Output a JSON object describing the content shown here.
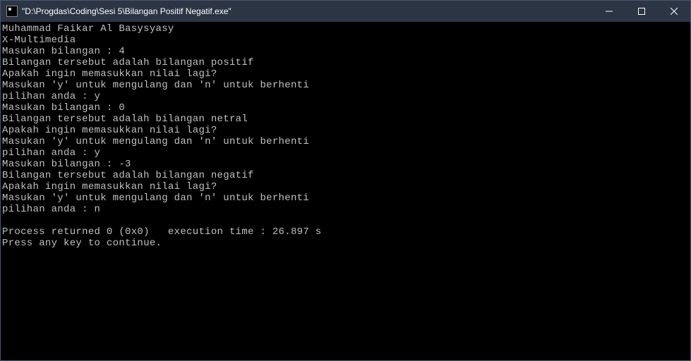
{
  "window": {
    "title": "\"D:\\Progdas\\Coding\\Sesi 5\\Bilangan Positif Negatif.exe\""
  },
  "console": {
    "lines": [
      "Muhammad Faikar Al Basysyasy",
      "X-Multimedia",
      "Masukan bilangan : 4",
      "Bilangan tersebut adalah bilangan positif",
      "Apakah ingin memasukkan nilai lagi?",
      "Masukan 'y' untuk mengulang dan 'n' untuk berhenti",
      "pilihan anda : y",
      "Masukan bilangan : 0",
      "Bilangan tersebut adalah bilangan netral",
      "Apakah ingin memasukkan nilai lagi?",
      "Masukan 'y' untuk mengulang dan 'n' untuk berhenti",
      "pilihan anda : y",
      "Masukan bilangan : -3",
      "Bilangan tersebut adalah bilangan negatif",
      "Apakah ingin memasukkan nilai lagi?",
      "Masukan 'y' untuk mengulang dan 'n' untuk berhenti",
      "pilihan anda : n",
      "",
      "Process returned 0 (0x0)   execution time : 26.897 s",
      "Press any key to continue."
    ]
  }
}
